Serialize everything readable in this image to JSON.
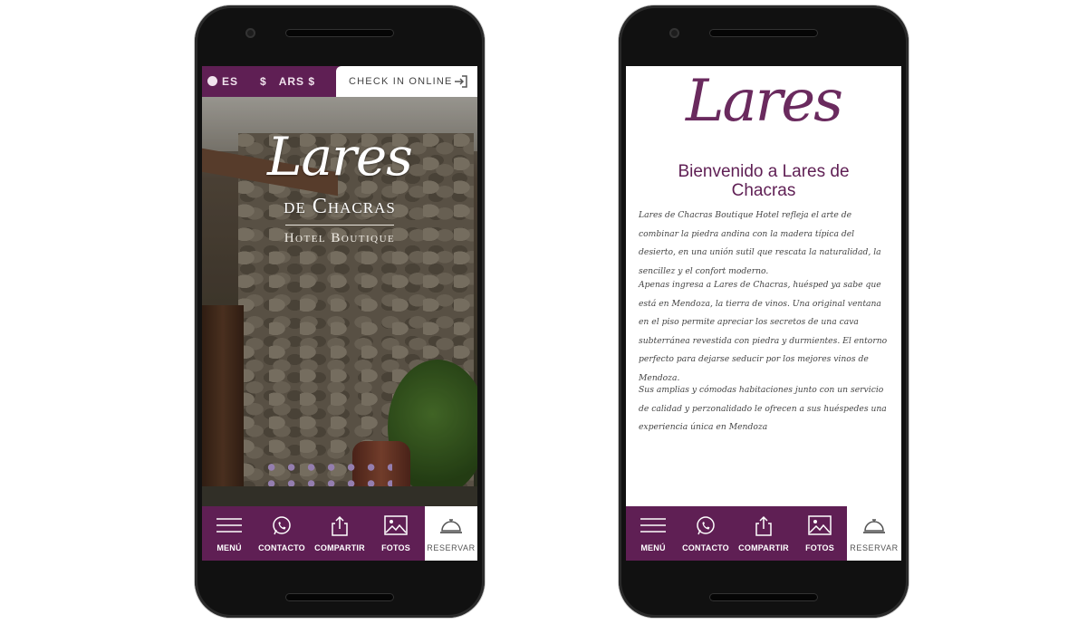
{
  "phone_left": {
    "topbar": {
      "language": "ES",
      "currency": "ARS $",
      "currency_symbol": "$",
      "checkin_label": "CHECK IN ONLINE"
    },
    "hero": {
      "logo_title": "Lares",
      "logo_subtitle": "de Chacras",
      "logo_tagline": "Hotel Boutique"
    },
    "bottom_nav": {
      "menu": "MENÚ",
      "contact": "CONTACTO",
      "share": "COMPARTIR",
      "photos": "FOTOS",
      "book": "RESERVAR"
    }
  },
  "phone_right": {
    "logo_title": "Lares",
    "welcome_heading": "Bienvenido a Lares de Chacras",
    "paragraphs": [
      "Lares de Chacras Boutique Hotel refleja el arte de combinar la piedra andina con la madera típica del desierto, en una unión sutil que rescata la naturalidad, la sencillez y el confort moderno.",
      "Apenas ingresa a Lares de Chacras, huésped ya sabe que está en Mendoza, la tierra de vinos. Una original ventana en el piso permite apreciar los secretos de una cava subterránea revestida con piedra y durmientes. El entorno perfecto para dejarse seducir por los mejores vinos de Mendoza.",
      "Sus amplias y cómodas habitaciones junto con un servicio de calidad y perzonalidado le ofrecen a sus huéspedes una experiencia única en Mendoza"
    ],
    "bottom_nav": {
      "menu": "MENÚ",
      "contact": "CONTACTO",
      "share": "COMPARTIR",
      "photos": "FOTOS",
      "book": "RESERVAR"
    }
  },
  "colors": {
    "brand_purple": "#5f1f54",
    "heading_purple": "#6a2a5e"
  }
}
